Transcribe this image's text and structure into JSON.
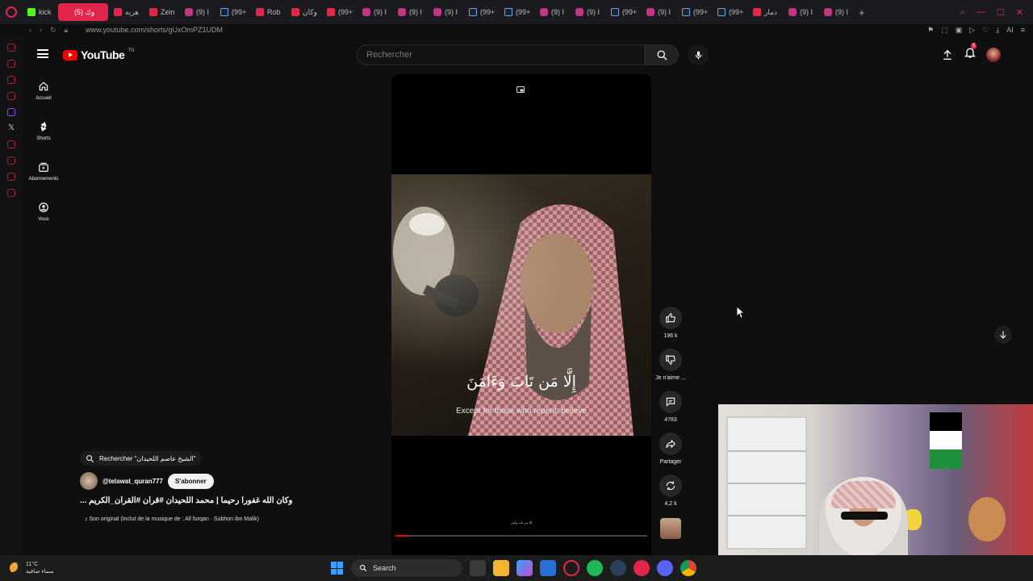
{
  "browser": {
    "tabs": [
      {
        "label": "kick",
        "icon": "kick"
      },
      {
        "label": "(5) وك",
        "icon": "youtube",
        "active": true
      },
      {
        "label": "هزيه",
        "icon": "youtube"
      },
      {
        "label": "Zein",
        "icon": "youtube"
      },
      {
        "label": "(9) I",
        "icon": "instagram"
      },
      {
        "label": "(99+",
        "icon": "tiktok"
      },
      {
        "label": "Rob",
        "icon": "youtube"
      },
      {
        "label": "وكان",
        "icon": "youtube"
      },
      {
        "label": "(99+",
        "icon": "youtube"
      },
      {
        "label": "(9) I",
        "icon": "instagram"
      },
      {
        "label": "(9) I",
        "icon": "instagram"
      },
      {
        "label": "(9) I",
        "icon": "instagram"
      },
      {
        "label": "(99+",
        "icon": "tiktok"
      },
      {
        "label": "(99+",
        "icon": "tiktok"
      },
      {
        "label": "(9) I",
        "icon": "instagram"
      },
      {
        "label": "(9) I",
        "icon": "instagram"
      },
      {
        "label": "(99+",
        "icon": "tiktok"
      },
      {
        "label": "(9) I",
        "icon": "instagram"
      },
      {
        "label": "(99+",
        "icon": "tiktok"
      },
      {
        "label": "(99+",
        "icon": "tiktok"
      },
      {
        "label": "دمار",
        "icon": "youtube"
      },
      {
        "label": "(9) I",
        "icon": "instagram"
      },
      {
        "label": "(9) I",
        "icon": "instagram"
      }
    ],
    "url": "www.youtube.com/shorts/gUxOmPZ1UDM",
    "ai_label": "AI"
  },
  "youtube": {
    "logo_text": "YouTube",
    "logo_region": "TN",
    "search_placeholder": "Rechercher",
    "notification_count": "5",
    "guide": [
      {
        "label": "Accueil",
        "icon": "home-icon"
      },
      {
        "label": "Shorts",
        "icon": "shorts-icon"
      },
      {
        "label": "Abonnements",
        "icon": "subscriptions-icon"
      },
      {
        "label": "Vous",
        "icon": "account-icon"
      }
    ]
  },
  "short": {
    "caption_arabic": "إِلَّا مَن تَابَ وَءَامَنَ",
    "caption_english": "Except for those who repent, believe",
    "tiny_text": "إلا من تاب وآمن",
    "progress": 0.05,
    "search_chip": "Rechercher \"الشيخ عاصم اللحيدان\"",
    "channel": "@telawat_quran777",
    "subscribe": "S'abonner",
    "title": "... وكان الله غفورا رحيما | محمد اللحيدان #قرآن #القرآن_الكريم",
    "sound": "Son original (Inclut de la musique de : All furqan · Subhon ibn Malik)",
    "actions": {
      "likes": "196 k",
      "dislike": "Je n'aime ...",
      "comments": "4783",
      "share": "Partager",
      "remix": "4,2 k"
    }
  },
  "taskbar": {
    "temperature": "11°C",
    "weather": "سماء صافية",
    "search": "Search"
  }
}
